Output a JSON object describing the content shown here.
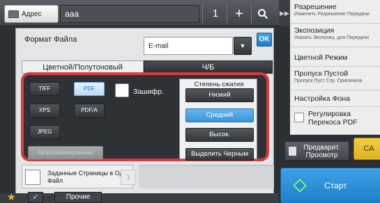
{
  "topbar": {
    "address_label": "Адрес",
    "address_value": "aaa",
    "count": "1",
    "plus": "+",
    "search_icon": "search-icon",
    "collapse_arrow": "▶▶"
  },
  "right_panel": {
    "items": [
      {
        "title": "Разрешение",
        "sub": "Изменить Разрешение Передачи"
      },
      {
        "title": "Экспозиция",
        "sub": "Указать Экспозиц. для Передачи"
      },
      {
        "title": "Цветной Режим",
        "sub": ""
      },
      {
        "title": "Пропуск Пустой",
        "sub": "Пропуск Пуст Стр. Оригинала"
      },
      {
        "title": "Настройка Фона",
        "sub": ""
      },
      {
        "title": "Регулировка Перекоса PDF",
        "sub": ""
      }
    ],
    "preview_label": "Предварит. Просмотр",
    "ca_label": "CA",
    "start_label": "Старт"
  },
  "main": {
    "file_format_label": "Формат Файла",
    "file_format_value": "E-mail",
    "ok_label": "OK",
    "tabs": [
      {
        "label": "Цветной/Полутоновый"
      },
      {
        "label": "Ч/Б"
      }
    ],
    "formats": [
      {
        "label": "TIFF"
      },
      {
        "label": "PDF"
      },
      {
        "label": "XPS"
      },
      {
        "label": "PDF/A"
      },
      {
        "label": "JPEG"
      },
      {
        "label": "Запрограммированно"
      }
    ],
    "selected_format": "PDF",
    "encrypt_label": "Зашифр.",
    "compression": {
      "title": "Степень сжатия",
      "options": [
        {
          "label": "Низкий"
        },
        {
          "label": "Средний"
        },
        {
          "label": "Высок."
        },
        {
          "label": "Выделить Черным"
        }
      ],
      "selected": "Средний"
    },
    "pages_label": "Заданные Страницы в Один Файл",
    "pages_value": "1"
  },
  "bottombar": {
    "other_label": "Прочие"
  },
  "colors": {
    "highlight_frame": "#d63c3a",
    "accent_blue": "#3b95da",
    "ca_yellow": "#ddb21f"
  }
}
